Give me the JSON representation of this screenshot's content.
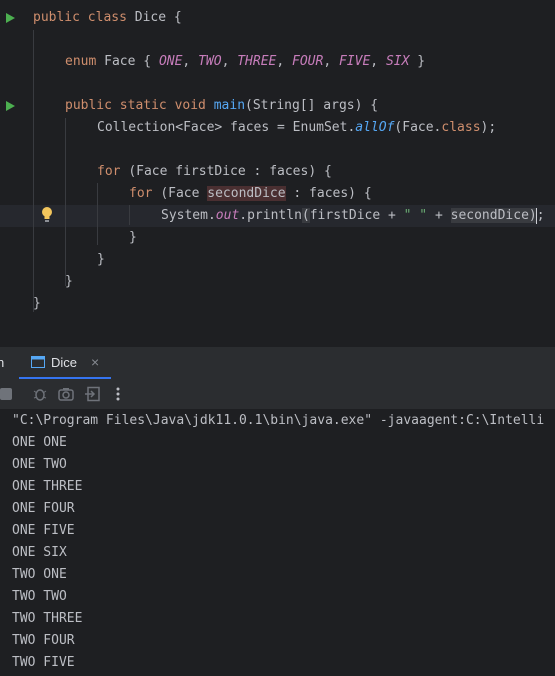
{
  "code": {
    "l1": {
      "kw": "public class",
      "name": "Dice",
      "brace": "{"
    },
    "l2": {
      "kw": "enum",
      "name": "Face",
      "open": "{",
      "consts": [
        "ONE",
        "TWO",
        "THREE",
        "FOUR",
        "FIVE",
        "SIX"
      ],
      "close": "}"
    },
    "l3": {
      "kw": "public static void",
      "fn": "main",
      "args": "(String[] args) {"
    },
    "l4": {
      "a": "Collection<Face> faces = EnumSet.",
      "m": "allOf",
      "b": "(Face.",
      "kw": "class",
      "c": ");"
    },
    "l5": {
      "kw": "for",
      "a": "(Face firstDice : faces) {"
    },
    "l6": {
      "kw": "for",
      "a": "(Face ",
      "v": "secondDice",
      "b": " : faces) {"
    },
    "l7": {
      "a": "System.",
      "f": "out",
      "b": ".println",
      "p": "(",
      "c": "firstDice + ",
      "s": "\" \"",
      "d": " + ",
      "v": "secondDice",
      "e": ")",
      "f2": ";"
    },
    "close1": "}",
    "close2": "}",
    "close3": "}",
    "close4": "}"
  },
  "run_panel": {
    "cut_label": "n",
    "tab_label": "Dice",
    "tab_close": "×"
  },
  "console": {
    "command": "\"C:\\Program Files\\Java\\jdk11.0.1\\bin\\java.exe\" -javaagent:C:\\Intelli",
    "lines": [
      "ONE ONE",
      "ONE TWO",
      "ONE THREE",
      "ONE FOUR",
      "ONE FIVE",
      "ONE SIX",
      "TWO ONE",
      "TWO TWO",
      "TWO THREE",
      "TWO FOUR",
      "TWO FIVE"
    ]
  },
  "icons": [
    "run-icon",
    "lightbulb-icon",
    "console-tab-icon",
    "stop-icon",
    "debug-icon",
    "camera-icon",
    "exit-icon",
    "more-icon"
  ],
  "colors": {
    "keyword": "#cf8e6d",
    "function": "#56a8f5",
    "enum_const": "#c77dbb",
    "string": "#6aab73",
    "run": "#4caf50"
  }
}
